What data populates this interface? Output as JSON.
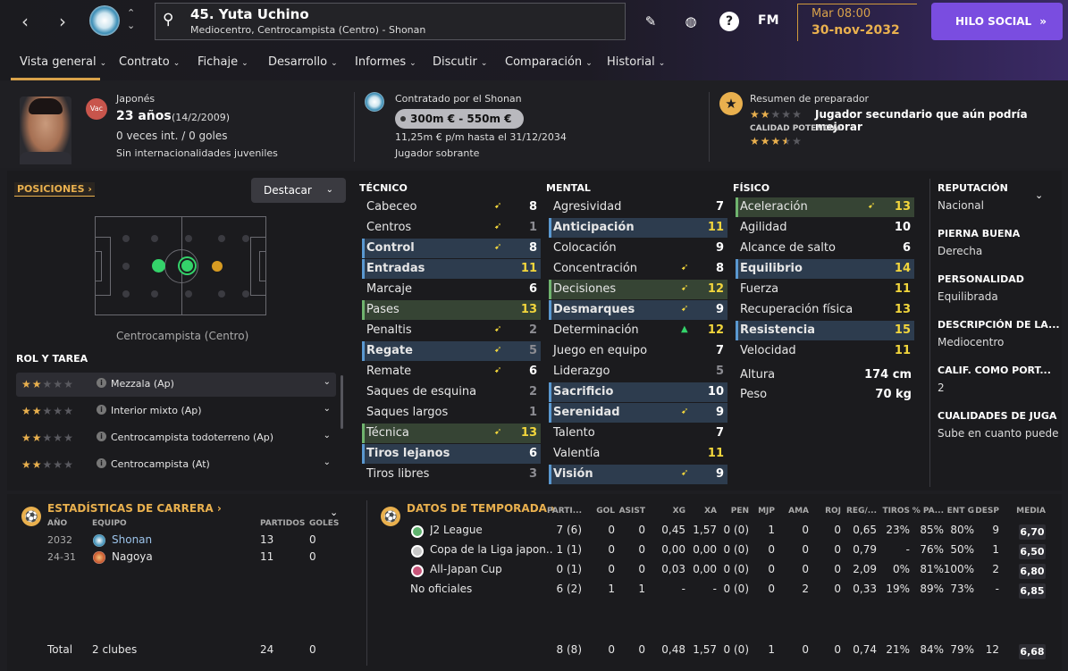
{
  "header": {
    "player_name": "45. Yuta Uchino",
    "player_sub": "Mediocentro, Centrocampista (Centro) - Shonan",
    "fm": "FM",
    "date_time": "Mar 08:00",
    "date_day": "30-nov-2032",
    "social_btn": "HILO SOCIAL",
    "social_arrow": "»"
  },
  "tabs": [
    {
      "label": "Vista general"
    },
    {
      "label": "Contrato"
    },
    {
      "label": "Fichaje"
    },
    {
      "label": "Desarrollo"
    },
    {
      "label": "Informes"
    },
    {
      "label": "Discutir"
    },
    {
      "label": "Comparación"
    },
    {
      "label": "Historial"
    }
  ],
  "profile": {
    "vac": "Vac",
    "nationality": "Japonés",
    "age": "23 años",
    "birth": "(14/2/2009)",
    "caps": "0 veces int. / 0 goles",
    "youth": "Sin internacionalidades juveniles"
  },
  "contract": {
    "by": "Contratado por el Shonan",
    "value": "300m € - 550m €",
    "wage": "11,25m € p/m hasta el 31/12/2034",
    "status": "Jugador sobrante"
  },
  "coach": {
    "title": "Resumen de preparador",
    "ability_stars": 2,
    "summary": "Jugador secundario que aún podría mejorar",
    "potential_label": "CALIDAD POTENCIAL",
    "potential_stars": 3.5
  },
  "positions": {
    "label": "POSICIONES",
    "highlight": "Destacar",
    "pitch_label": "Centrocampista (Centro)"
  },
  "roles": {
    "title": "ROL Y TAREA",
    "items": [
      {
        "label": "Mezzala (Ap)",
        "stars": 2
      },
      {
        "label": "Interior mixto (Ap)",
        "stars": 2
      },
      {
        "label": "Centrocampista todoterreno (Ap)",
        "stars": 2
      },
      {
        "label": "Centrocampista (At)",
        "stars": 2
      }
    ]
  },
  "attributes": {
    "technical_title": "TÉCNICO",
    "mental_title": "MENTAL",
    "physical_title": "FÍSICO",
    "technical": [
      {
        "n": "Cabeceo",
        "v": "8",
        "hl": "",
        "ar": "y",
        "vc": "w"
      },
      {
        "n": "Centros",
        "v": "1",
        "hl": "",
        "ar": "y",
        "vc": "d"
      },
      {
        "n": "Control",
        "v": "8",
        "hl": "b",
        "ar": "y",
        "vc": "w"
      },
      {
        "n": "Entradas",
        "v": "11",
        "hl": "b",
        "ar": "",
        "vc": "y"
      },
      {
        "n": "Marcaje",
        "v": "6",
        "hl": "",
        "ar": "",
        "vc": "w"
      },
      {
        "n": "Pases",
        "v": "13",
        "hl": "g",
        "ar": "",
        "vc": "y"
      },
      {
        "n": "Penaltis",
        "v": "2",
        "hl": "",
        "ar": "y",
        "vc": "d"
      },
      {
        "n": "Regate",
        "v": "5",
        "hl": "b",
        "ar": "y",
        "vc": "d"
      },
      {
        "n": "Remate",
        "v": "6",
        "hl": "",
        "ar": "y",
        "vc": "w"
      },
      {
        "n": "Saques de esquina",
        "v": "2",
        "hl": "",
        "ar": "",
        "vc": "d"
      },
      {
        "n": "Saques largos",
        "v": "1",
        "hl": "",
        "ar": "",
        "vc": "d"
      },
      {
        "n": "Técnica",
        "v": "13",
        "hl": "g",
        "ar": "y",
        "vc": "y"
      },
      {
        "n": "Tiros lejanos",
        "v": "6",
        "hl": "b",
        "ar": "",
        "vc": "w"
      },
      {
        "n": "Tiros libres",
        "v": "3",
        "hl": "",
        "ar": "",
        "vc": "d"
      }
    ],
    "mental": [
      {
        "n": "Agresividad",
        "v": "7",
        "hl": "",
        "ar": "",
        "vc": "w"
      },
      {
        "n": "Anticipación",
        "v": "11",
        "hl": "b",
        "ar": "",
        "vc": "y"
      },
      {
        "n": "Colocación",
        "v": "9",
        "hl": "",
        "ar": "",
        "vc": "w"
      },
      {
        "n": "Concentración",
        "v": "8",
        "hl": "",
        "ar": "y",
        "vc": "w"
      },
      {
        "n": "Decisiones",
        "v": "12",
        "hl": "g",
        "ar": "y",
        "vc": "y"
      },
      {
        "n": "Desmarques",
        "v": "9",
        "hl": "b",
        "ar": "y",
        "vc": "w"
      },
      {
        "n": "Determinación",
        "v": "12",
        "hl": "",
        "ar": "up",
        "vc": "y"
      },
      {
        "n": "Juego en equipo",
        "v": "7",
        "hl": "",
        "ar": "",
        "vc": "w"
      },
      {
        "n": "Liderazgo",
        "v": "5",
        "hl": "",
        "ar": "",
        "vc": "d"
      },
      {
        "n": "Sacrificio",
        "v": "10",
        "hl": "b",
        "ar": "",
        "vc": "w"
      },
      {
        "n": "Serenidad",
        "v": "9",
        "hl": "b",
        "ar": "y",
        "vc": "w"
      },
      {
        "n": "Talento",
        "v": "7",
        "hl": "",
        "ar": "",
        "vc": "w"
      },
      {
        "n": "Valentía",
        "v": "11",
        "hl": "",
        "ar": "",
        "vc": "y"
      },
      {
        "n": "Visión",
        "v": "9",
        "hl": "b",
        "ar": "y",
        "vc": "w"
      }
    ],
    "physical": [
      {
        "n": "Aceleración",
        "v": "13",
        "hl": "g",
        "ar": "y",
        "vc": "y"
      },
      {
        "n": "Agilidad",
        "v": "10",
        "hl": "",
        "ar": "",
        "vc": "w"
      },
      {
        "n": "Alcance de salto",
        "v": "6",
        "hl": "",
        "ar": "",
        "vc": "w"
      },
      {
        "n": "Equilibrio",
        "v": "14",
        "hl": "b",
        "ar": "",
        "vc": "y"
      },
      {
        "n": "Fuerza",
        "v": "11",
        "hl": "",
        "ar": "",
        "vc": "y"
      },
      {
        "n": "Recuperación física",
        "v": "13",
        "hl": "",
        "ar": "",
        "vc": "y"
      },
      {
        "n": "Resistencia",
        "v": "15",
        "hl": "b",
        "ar": "",
        "vc": "y"
      },
      {
        "n": "Velocidad",
        "v": "11",
        "hl": "",
        "ar": "",
        "vc": "y"
      }
    ],
    "height_label": "Altura",
    "height": "174 cm",
    "weight_label": "Peso",
    "weight": "70 kg"
  },
  "info": [
    {
      "h": "REPUTACIÓN",
      "v": "Nacional"
    },
    {
      "h": "PIERNA BUENA",
      "v": "Derecha"
    },
    {
      "h": "PERSONALIDAD",
      "v": "Equilibrada"
    },
    {
      "h": "DESCRIPCIÓN DE LA...",
      "v": "Mediocentro"
    },
    {
      "h": "CALIF. COMO PORT...",
      "v": "2"
    },
    {
      "h": "CUALIDADES DE JUGA",
      "v": "Sube en cuanto puede"
    }
  ],
  "career": {
    "title": "ESTADÍSTICAS DE CARRERA",
    "cols": {
      "year": "AÑO",
      "team": "EQUIPO",
      "apps": "PARTIDOS",
      "goals": "GOLES"
    },
    "rows": [
      {
        "year": "2032",
        "team": "Shonan",
        "apps": "13",
        "goals": "0"
      },
      {
        "year": "24-31",
        "team": "Nagoya",
        "apps": "11",
        "goals": "0"
      }
    ],
    "total": {
      "label": "Total",
      "team": "2 clubes",
      "apps": "24",
      "goals": "0"
    }
  },
  "season": {
    "title": "DATOS DE TEMPORADA",
    "cols": [
      "PARTI...",
      "GOL",
      "ASIST",
      "XG",
      "XA",
      "PEN",
      "MJP",
      "AMA",
      "ROJ",
      "REG/...",
      "TIROS",
      "% PA...",
      "ENT G",
      "DESP",
      "MEDIA"
    ],
    "rows": [
      {
        "comp": "J2 League",
        "vals": [
          "7 (6)",
          "0",
          "0",
          "0,45",
          "1,57",
          "0 (0)",
          "1",
          "0",
          "0",
          "0,65",
          "23%",
          "85%",
          "80%",
          "9",
          "6,70"
        ]
      },
      {
        "comp": "Copa de la Liga japon...",
        "vals": [
          "1 (1)",
          "0",
          "0",
          "0,00",
          "0,00",
          "0 (0)",
          "0",
          "0",
          "0",
          "0,79",
          "-",
          "76%",
          "50%",
          "1",
          "6,50"
        ]
      },
      {
        "comp": "All-Japan Cup",
        "vals": [
          "0 (1)",
          "0",
          "0",
          "0,03",
          "0,00",
          "0 (0)",
          "0",
          "0",
          "0",
          "2,09",
          "0%",
          "81%",
          "100%",
          "2",
          "6,80"
        ]
      },
      {
        "comp": "No oficiales",
        "vals": [
          "6 (2)",
          "1",
          "1",
          "-",
          "-",
          "0 (0)",
          "0",
          "2",
          "0",
          "0,33",
          "19%",
          "89%",
          "73%",
          "-",
          "6,85"
        ]
      }
    ],
    "total": [
      "8 (8)",
      "0",
      "0",
      "0,48",
      "1,57",
      "0 (0)",
      "1",
      "0",
      "0",
      "0,74",
      "21%",
      "84%",
      "79%",
      "12",
      "6,68"
    ]
  }
}
